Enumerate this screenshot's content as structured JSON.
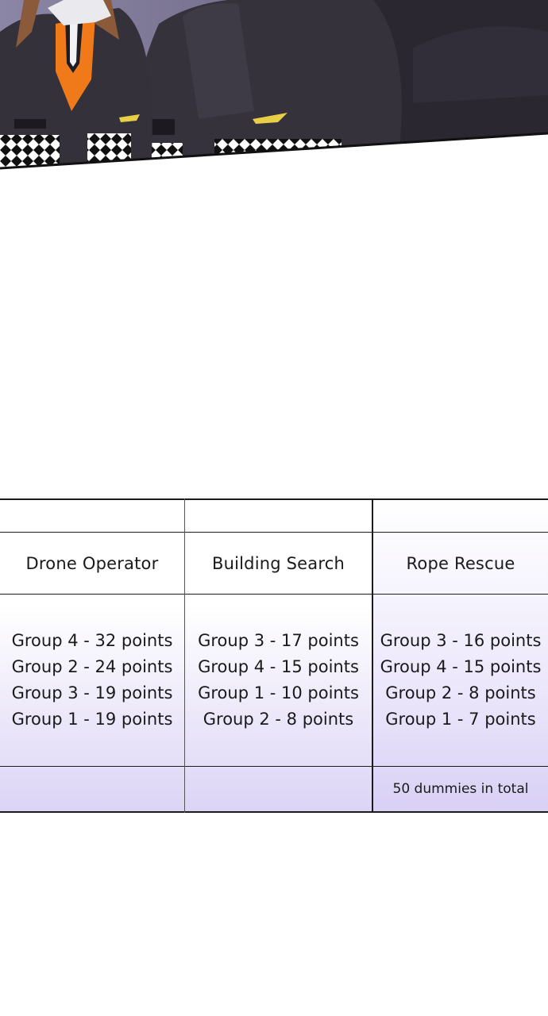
{
  "table": {
    "columns": [
      {
        "header": "Drone Operator",
        "scores": [
          "Group 4 - 32 points",
          "Group 2 - 24 points",
          "Group 3 - 19 points",
          "Group 1 - 19 points"
        ],
        "note": ""
      },
      {
        "header": "Building Search",
        "scores": [
          "Group 3 - 17 points",
          "Group 4 - 15 points",
          "Group 1 - 10 points",
          "Group 2 - 8 points"
        ],
        "note": ""
      },
      {
        "header": "Rope Rescue",
        "scores": [
          "Group 3 - 16 points",
          "Group 4 - 15 points",
          "Group 2 - 8 points",
          "Group 1 - 7 points"
        ],
        "note": "50 dummies in total"
      }
    ]
  },
  "colors": {
    "line": "#1b1b1b",
    "tint": "#e2dcf7",
    "jacket": "#35323c",
    "background_art": "#6f6a86",
    "accent_orange": "#f07a1a",
    "hair": "#8a5a3a",
    "badge_yellow": "#e8cf45"
  }
}
